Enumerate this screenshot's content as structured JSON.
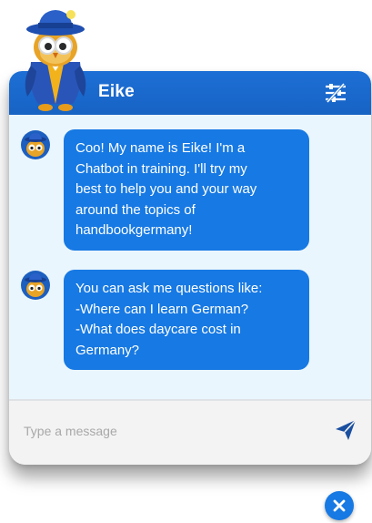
{
  "header": {
    "title": "Eike",
    "filter_icon": "filter-icon"
  },
  "messages": [
    {
      "lines": [
        "Coo! My name is Eike! I'm a",
        "Chatbot in training. I'll try my",
        "best to help you and your way",
        "around the topics of",
        "handbookgermany!"
      ]
    },
    {
      "lines": [
        "You can ask me questions like:",
        "-Where can I learn German?",
        "-What does daycare cost in",
        "Germany?"
      ]
    }
  ],
  "input": {
    "value": "",
    "placeholder": "Type a message",
    "send_icon": "send-icon"
  },
  "close_icon": "close-icon",
  "colors": {
    "primary": "#1779e3",
    "header": "#1d6fd6",
    "body_background": "#eaf6fd",
    "input_background": "#f3f3f3"
  }
}
